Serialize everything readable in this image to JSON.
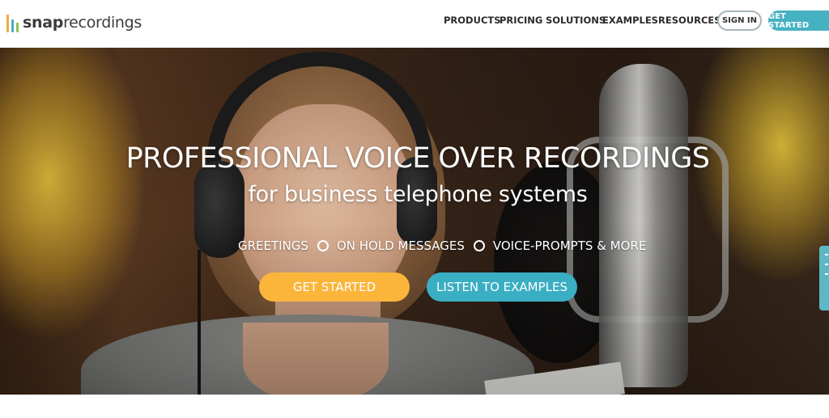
{
  "header": {
    "logo": {
      "bold": "snap",
      "rest": "recordings",
      "bar_colors": [
        "#f2a93b",
        "#46b1c1",
        "#8cc34a",
        "#d0d0d0"
      ]
    },
    "nav": [
      "PRODUCTS",
      "PRICING",
      "SOLUTIONS",
      "EXAMPLES",
      "RESOURCES"
    ],
    "sign_in": "SIGN IN",
    "get_started": "GET STARTED"
  },
  "hero": {
    "title": "PROFESSIONAL VOICE OVER RECORDINGS",
    "subtitle": "for business telephone systems",
    "features": [
      "GREETINGS",
      "ON HOLD MESSAGES",
      "VOICE-PROMPTS & MORE"
    ],
    "cta_primary": "GET STARTED",
    "cta_secondary": "LISTEN TO EXAMPLES"
  },
  "colors": {
    "accent_teal": "#46b1c1",
    "accent_orange": "#fbb53a"
  }
}
